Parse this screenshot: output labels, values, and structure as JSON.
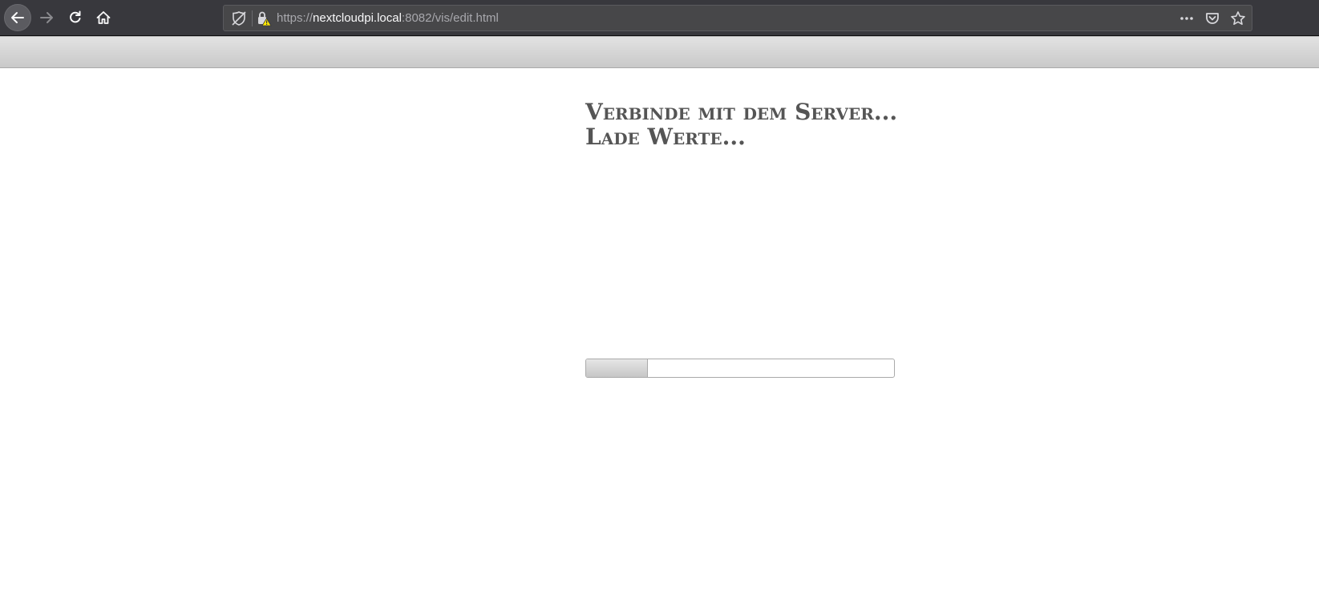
{
  "browser": {
    "url": {
      "scheme": "https://",
      "host": "nextcloudpi.local",
      "rest": ":8082/vis/edit.html"
    },
    "icons": {
      "back": "arrow-left-icon",
      "forward": "arrow-right-icon",
      "reload": "reload-icon",
      "home": "home-icon",
      "tracking": "tracking-protection-icon",
      "lock": "lock-warning-icon",
      "more": "more-actions-icon",
      "pocket": "pocket-icon",
      "bookmark": "star-icon"
    }
  },
  "loading": {
    "messages": [
      "Verbinde mit dem Server...",
      "Lade Werte..."
    ],
    "progress_fraction": 0.2
  },
  "colors": {
    "toolbar_bg": "#38383d",
    "urlbar_bg": "#474749",
    "header_bar": "#d0d0d0",
    "text": "#555555"
  }
}
